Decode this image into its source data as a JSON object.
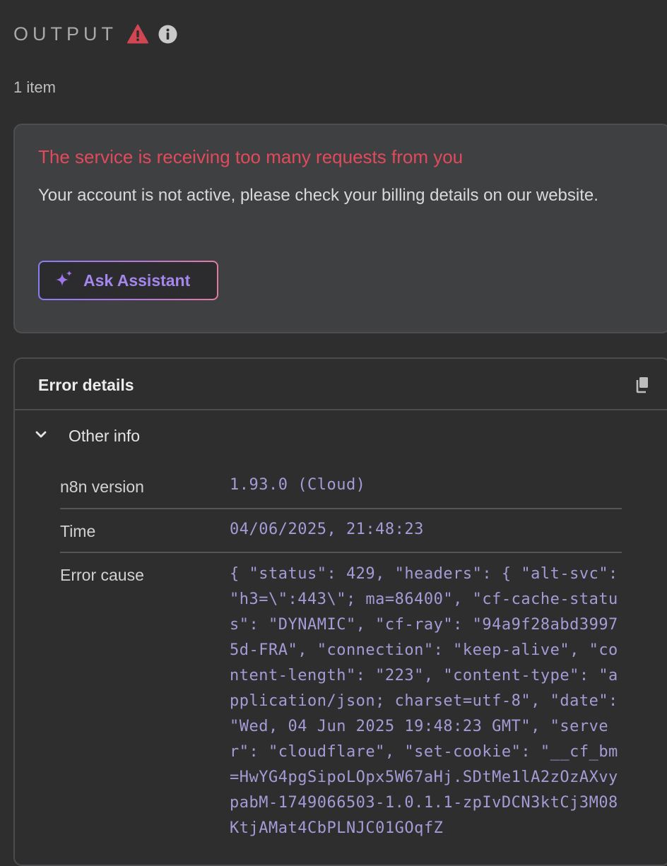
{
  "panel": {
    "title": "OUTPUT",
    "item_count": "1 item"
  },
  "error": {
    "title": "The service is receiving too many requests from you",
    "description": "Your account is not active, please check your billing details on our website.",
    "ask_button_label": "Ask Assistant"
  },
  "details": {
    "title": "Error details",
    "section_label": "Other info",
    "rows": [
      {
        "key": "n8n version",
        "value": "1.93.0 (Cloud)"
      },
      {
        "key": "Time",
        "value": "04/06/2025, 21:48:23"
      },
      {
        "key": "Error cause",
        "value": "{ \"status\": 429, \"headers\": { \"alt-svc\": \"h3=\\\":443\\\"; ma=86400\", \"cf-cache-status\": \"DYNAMIC\", \"cf-ray\": \"94a9f28abd39975d-FRA\", \"connection\": \"keep-alive\", \"content-length\": \"223\", \"content-type\": \"application/json; charset=utf-8\", \"date\": \"Wed, 04 Jun 2025 19:48:23 GMT\", \"server\": \"cloudflare\", \"set-cookie\": \"__cf_bm=HwYG4pgSipoLOpx5W67aHj.SDtMe1lA2zOzAXvypabM-1749066503-1.0.1.1-zpIvDCN3ktCj3M08KtjAMat4CbPLNJC01GOqfZ"
      }
    ]
  },
  "colors": {
    "background": "#2e2e2e",
    "error_text": "#e04a5b",
    "warning_icon": "#d24553",
    "mono_value": "#a59bd6",
    "assistant_accent": "#a486ec"
  },
  "icons": [
    "warning-icon",
    "info-icon",
    "sparkle-icon",
    "copy-icon",
    "chevron-down-icon"
  ]
}
